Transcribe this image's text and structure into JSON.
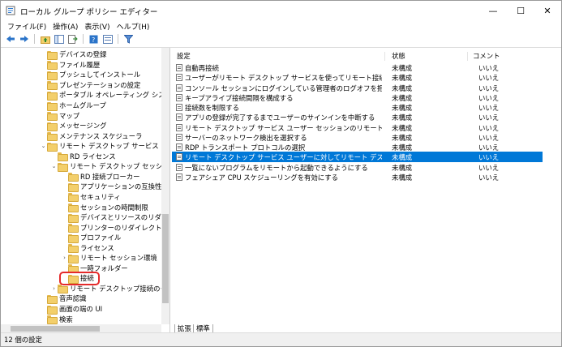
{
  "window": {
    "title": "ローカル グループ ポリシー エディター",
    "minimize": "—",
    "maximize": "☐",
    "close": "✕"
  },
  "menu": [
    "ファイル(F)",
    "操作(A)",
    "表示(V)",
    "ヘルプ(H)"
  ],
  "tree": [
    {
      "label": "デバイスの登録",
      "indent": 0,
      "chev": ""
    },
    {
      "label": "ファイル履歴",
      "indent": 0,
      "chev": ""
    },
    {
      "label": "プッシュしてインストール",
      "indent": 0,
      "chev": ""
    },
    {
      "label": "プレゼンテーションの設定",
      "indent": 0,
      "chev": ""
    },
    {
      "label": "ポータブル オペレーティング システム",
      "indent": 0,
      "chev": ""
    },
    {
      "label": "ホームグループ",
      "indent": 0,
      "chev": ""
    },
    {
      "label": "マップ",
      "indent": 0,
      "chev": ""
    },
    {
      "label": "メッセージング",
      "indent": 0,
      "chev": ""
    },
    {
      "label": "メンテナンス スケジューラ",
      "indent": 0,
      "chev": ""
    },
    {
      "label": "リモート デスクトップ サービス",
      "indent": 0,
      "chev": "v"
    },
    {
      "label": "RD ライセンス",
      "indent": 1,
      "chev": ""
    },
    {
      "label": "リモート デスクトップ セッション ホス",
      "indent": 1,
      "chev": "v"
    },
    {
      "label": "RD 接続ブローカー",
      "indent": 2,
      "chev": ""
    },
    {
      "label": "アプリケーションの互換性",
      "indent": 2,
      "chev": ""
    },
    {
      "label": "セキュリティ",
      "indent": 2,
      "chev": ""
    },
    {
      "label": "セッションの時間制限",
      "indent": 2,
      "chev": ""
    },
    {
      "label": "デバイスとリソースのリダイレク",
      "indent": 2,
      "chev": ""
    },
    {
      "label": "プリンターのリダイレクト",
      "indent": 2,
      "chev": ""
    },
    {
      "label": "プロファイル",
      "indent": 2,
      "chev": ""
    },
    {
      "label": "ライセンス",
      "indent": 2,
      "chev": ""
    },
    {
      "label": "リモート セッション環境",
      "indent": 2,
      "chev": ">"
    },
    {
      "label": "一時フォルダー",
      "indent": 2,
      "chev": ""
    },
    {
      "label": "接続",
      "indent": 2,
      "chev": ""
    },
    {
      "label": "リモート デスクトップ接続のクライア",
      "indent": 1,
      "chev": ">"
    },
    {
      "label": "音声認識",
      "indent": 0,
      "chev": ""
    },
    {
      "label": "画面の端の UI",
      "indent": 0,
      "chev": ""
    },
    {
      "label": "検索",
      "indent": 0,
      "chev": ""
    }
  ],
  "list": {
    "headers": {
      "setting": "設定",
      "state": "状態",
      "comment": "コメント"
    },
    "rows": [
      {
        "setting": "自動再接続",
        "state": "未構成",
        "comment": "いいえ"
      },
      {
        "setting": "ユーザーがリモート デスクトップ サービスを使ってリモート接続することを...",
        "state": "未構成",
        "comment": "いいえ"
      },
      {
        "setting": "コンソール セッションにログインしている管理者のログオフを拒否する",
        "state": "未構成",
        "comment": "いいえ"
      },
      {
        "setting": "キープアライブ接続間隔を構成する",
        "state": "未構成",
        "comment": "いいえ"
      },
      {
        "setting": "接続数を制限する",
        "state": "未構成",
        "comment": "いいえ"
      },
      {
        "setting": "アプリの登録が完了するまでユーザーのサインインを中断する",
        "state": "未構成",
        "comment": "いいえ"
      },
      {
        "setting": "リモート デスクトップ サービス ユーザー セッションのリモート制御のルール...",
        "state": "未構成",
        "comment": "いいえ"
      },
      {
        "setting": "サーバーのネットワーク検出を選択する",
        "state": "未構成",
        "comment": "いいえ"
      },
      {
        "setting": "RDP トランスポート プロトコルの選択",
        "state": "未構成",
        "comment": "いいえ"
      },
      {
        "setting": "リモート デスクトップ サービス ユーザーに対してリモート デスクトップ サー...",
        "state": "未構成",
        "comment": "いいえ"
      },
      {
        "setting": "一覧にないプログラムをリモートから起動できるようにする",
        "state": "未構成",
        "comment": "いいえ"
      },
      {
        "setting": "フェアシェア CPU スケジューリングを有効にする",
        "state": "未構成",
        "comment": "いいえ"
      }
    ]
  },
  "tabs": {
    "extended": "拡張",
    "standard": "標準"
  },
  "status": "12 個の設定",
  "colors": {
    "selection": "#0078d7",
    "highlight": "#e52b2b",
    "folder": "#f3cf6b"
  }
}
